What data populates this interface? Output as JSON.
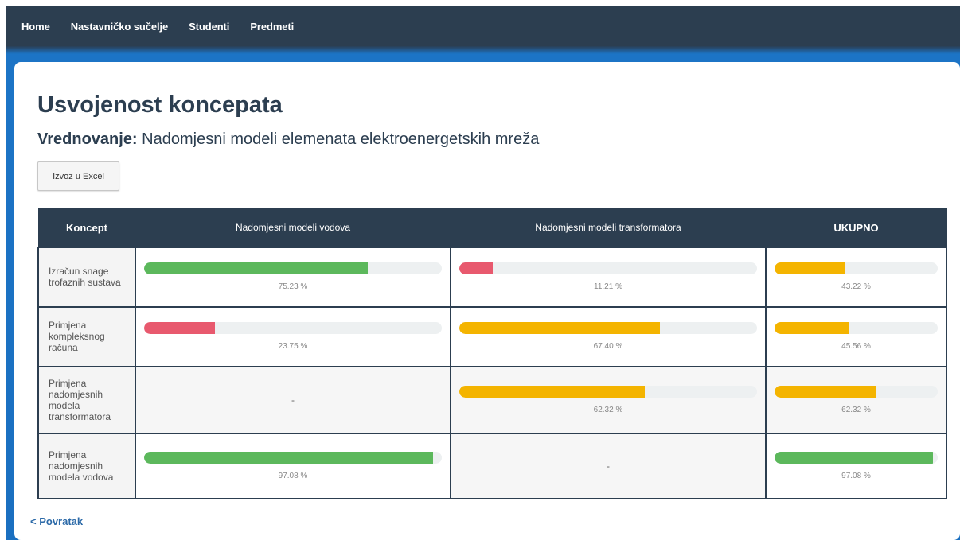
{
  "nav": {
    "items": [
      "Home",
      "Nastavničko sučelje",
      "Studenti",
      "Predmeti"
    ]
  },
  "title": "Usvojenost koncepata",
  "subtitle": {
    "label": "Vrednovanje:",
    "value": "Nadomjesni modeli elemenata elektroenergetskih mreža"
  },
  "export_button": "Izvoz u Excel",
  "table": {
    "headers": [
      "Koncept",
      "Nadomjesni modeli vodova",
      "Nadomjesni modeli transformatora",
      "UKUPNO"
    ],
    "rows": [
      {
        "concept": "Izračun snage trofaznih sustava",
        "cells": [
          {
            "value": 75.23,
            "text": "75.23 %",
            "color": "#5cb85c"
          },
          {
            "value": 11.21,
            "text": "11.21 %",
            "color": "#e8596e"
          },
          {
            "value": 43.22,
            "text": "43.22 %",
            "color": "#f4b400"
          }
        ]
      },
      {
        "concept": "Primjena kompleksnog računa",
        "cells": [
          {
            "value": 23.75,
            "text": "23.75 %",
            "color": "#e8596e"
          },
          {
            "value": 67.4,
            "text": "67.40 %",
            "color": "#f4b400"
          },
          {
            "value": 45.56,
            "text": "45.56 %",
            "color": "#f4b400"
          }
        ]
      },
      {
        "concept": "Primjena nadomjesnih modela transformatora",
        "cells": [
          {
            "value": null,
            "text": "-"
          },
          {
            "value": 62.32,
            "text": "62.32 %",
            "color": "#f4b400"
          },
          {
            "value": 62.32,
            "text": "62.32 %",
            "color": "#f4b400"
          }
        ]
      },
      {
        "concept": "Primjena nadomjesnih modela vodova",
        "cells": [
          {
            "value": 97.08,
            "text": "97.08 %",
            "color": "#5cb85c"
          },
          {
            "value": null,
            "text": "-"
          },
          {
            "value": 97.08,
            "text": "97.08 %",
            "color": "#5cb85c"
          }
        ]
      }
    ]
  },
  "back_link": "< Povratak"
}
